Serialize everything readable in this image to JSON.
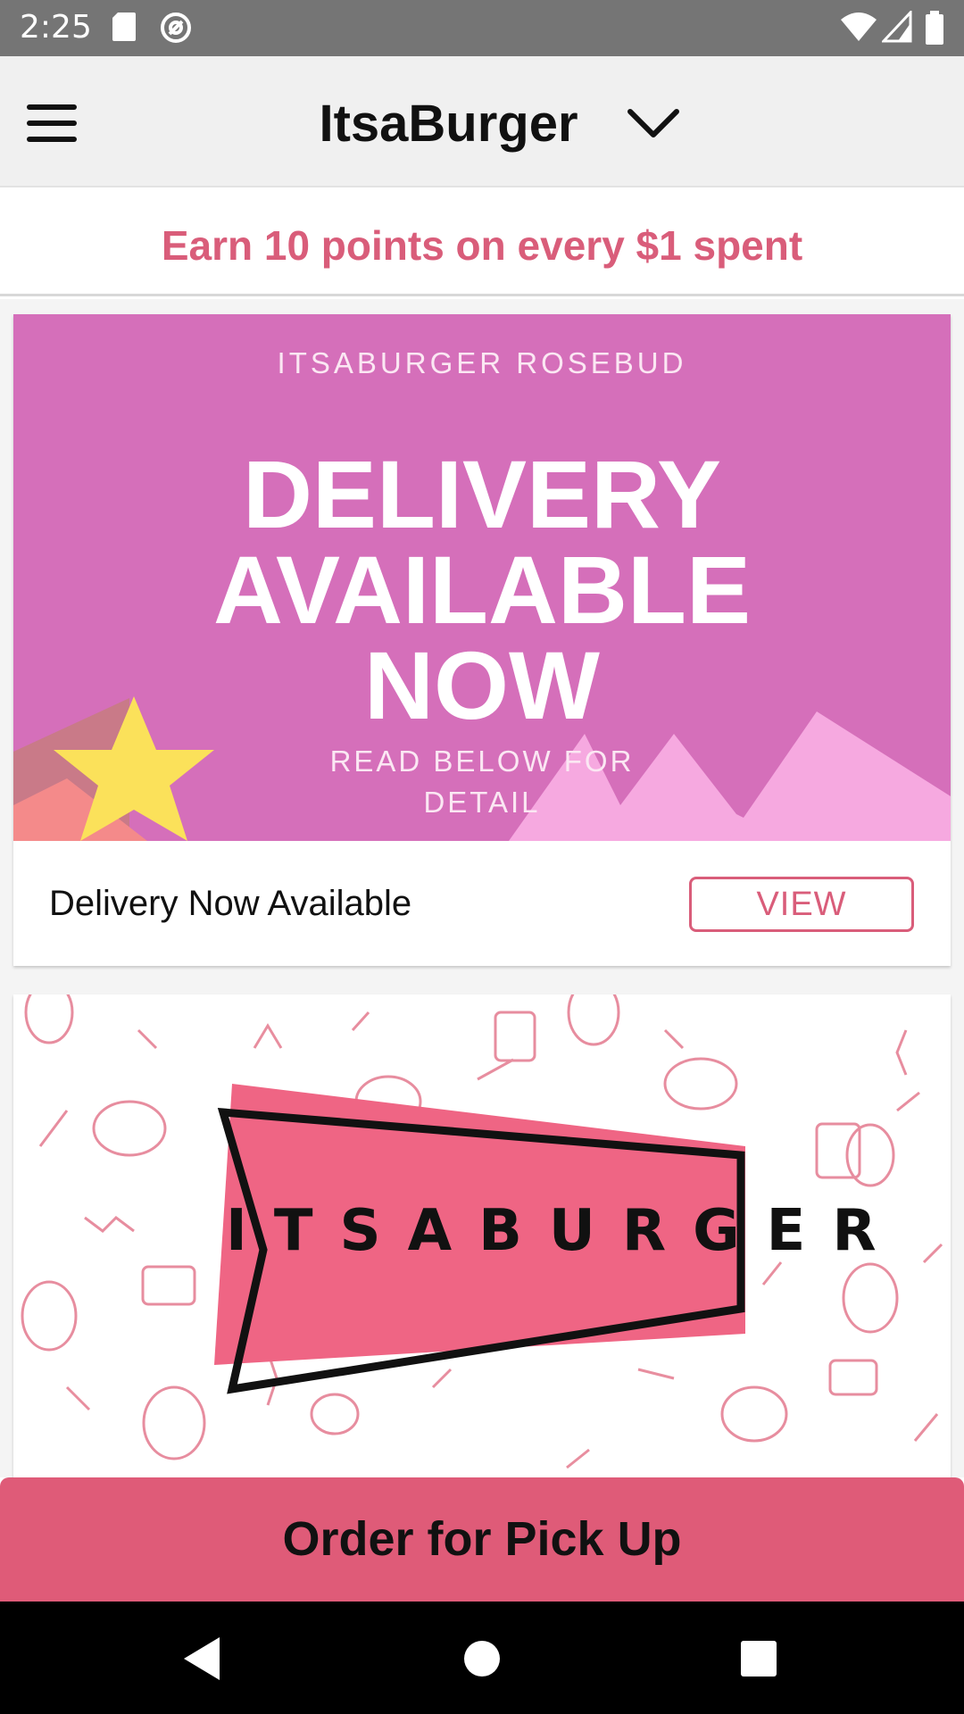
{
  "status_bar": {
    "time": "2:25",
    "icons": [
      "sd-card-icon",
      "sync-icon",
      "wifi-icon",
      "signal-icon",
      "battery-icon"
    ]
  },
  "header": {
    "title": "ItsaBurger",
    "menu_icon": "hamburger-menu-icon",
    "dropdown_icon": "chevron-down-icon"
  },
  "promo": {
    "text": "Earn 10 points on every $1 spent",
    "color": "#d95d7a"
  },
  "cards": [
    {
      "banner": {
        "subtitle": "ITSABURGER ROSEBUD",
        "line1": "DELIVERY",
        "line2": "AVAILABLE",
        "line3": "NOW",
        "small1": "READ BELOW FOR",
        "small2": "DETAIL",
        "background": "#d56fba"
      },
      "title": "Delivery Now Available",
      "button_label": "VIEW"
    },
    {
      "banner": {
        "logo_text": "ITSABURGER",
        "accent": "#ef6584"
      }
    }
  ],
  "order_button": {
    "label": "Order for Pick Up",
    "color": "#df5b78"
  },
  "nav": {
    "back_icon": "back-triangle-icon",
    "home_icon": "home-circle-icon",
    "recents_icon": "recents-square-icon"
  }
}
